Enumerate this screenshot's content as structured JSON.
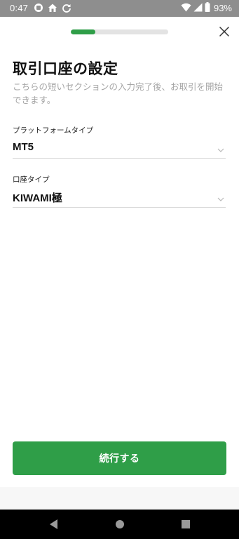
{
  "status_bar": {
    "time": "0:47",
    "battery": "93%"
  },
  "progress": {
    "fraction": 0.25
  },
  "header": {
    "title": "取引口座の設定",
    "subtitle": "こちらの短いセクションの入力完了後、お取引を開始できます。"
  },
  "fields": {
    "platform": {
      "label": "プラットフォームタイプ",
      "value": "MT5"
    },
    "account": {
      "label": "口座タイプ",
      "value": "KIWAMI極"
    }
  },
  "actions": {
    "continue_label": "続行する"
  },
  "colors": {
    "accent": "#2f9e48",
    "status_bar": "#8e8e8e",
    "subtitle": "#a6a6a6"
  },
  "icons": {
    "close": "close-icon",
    "chevron": "chevron-down-icon",
    "back": "back-triangle-icon",
    "home": "home-circle-icon",
    "recent": "recent-square-icon"
  }
}
